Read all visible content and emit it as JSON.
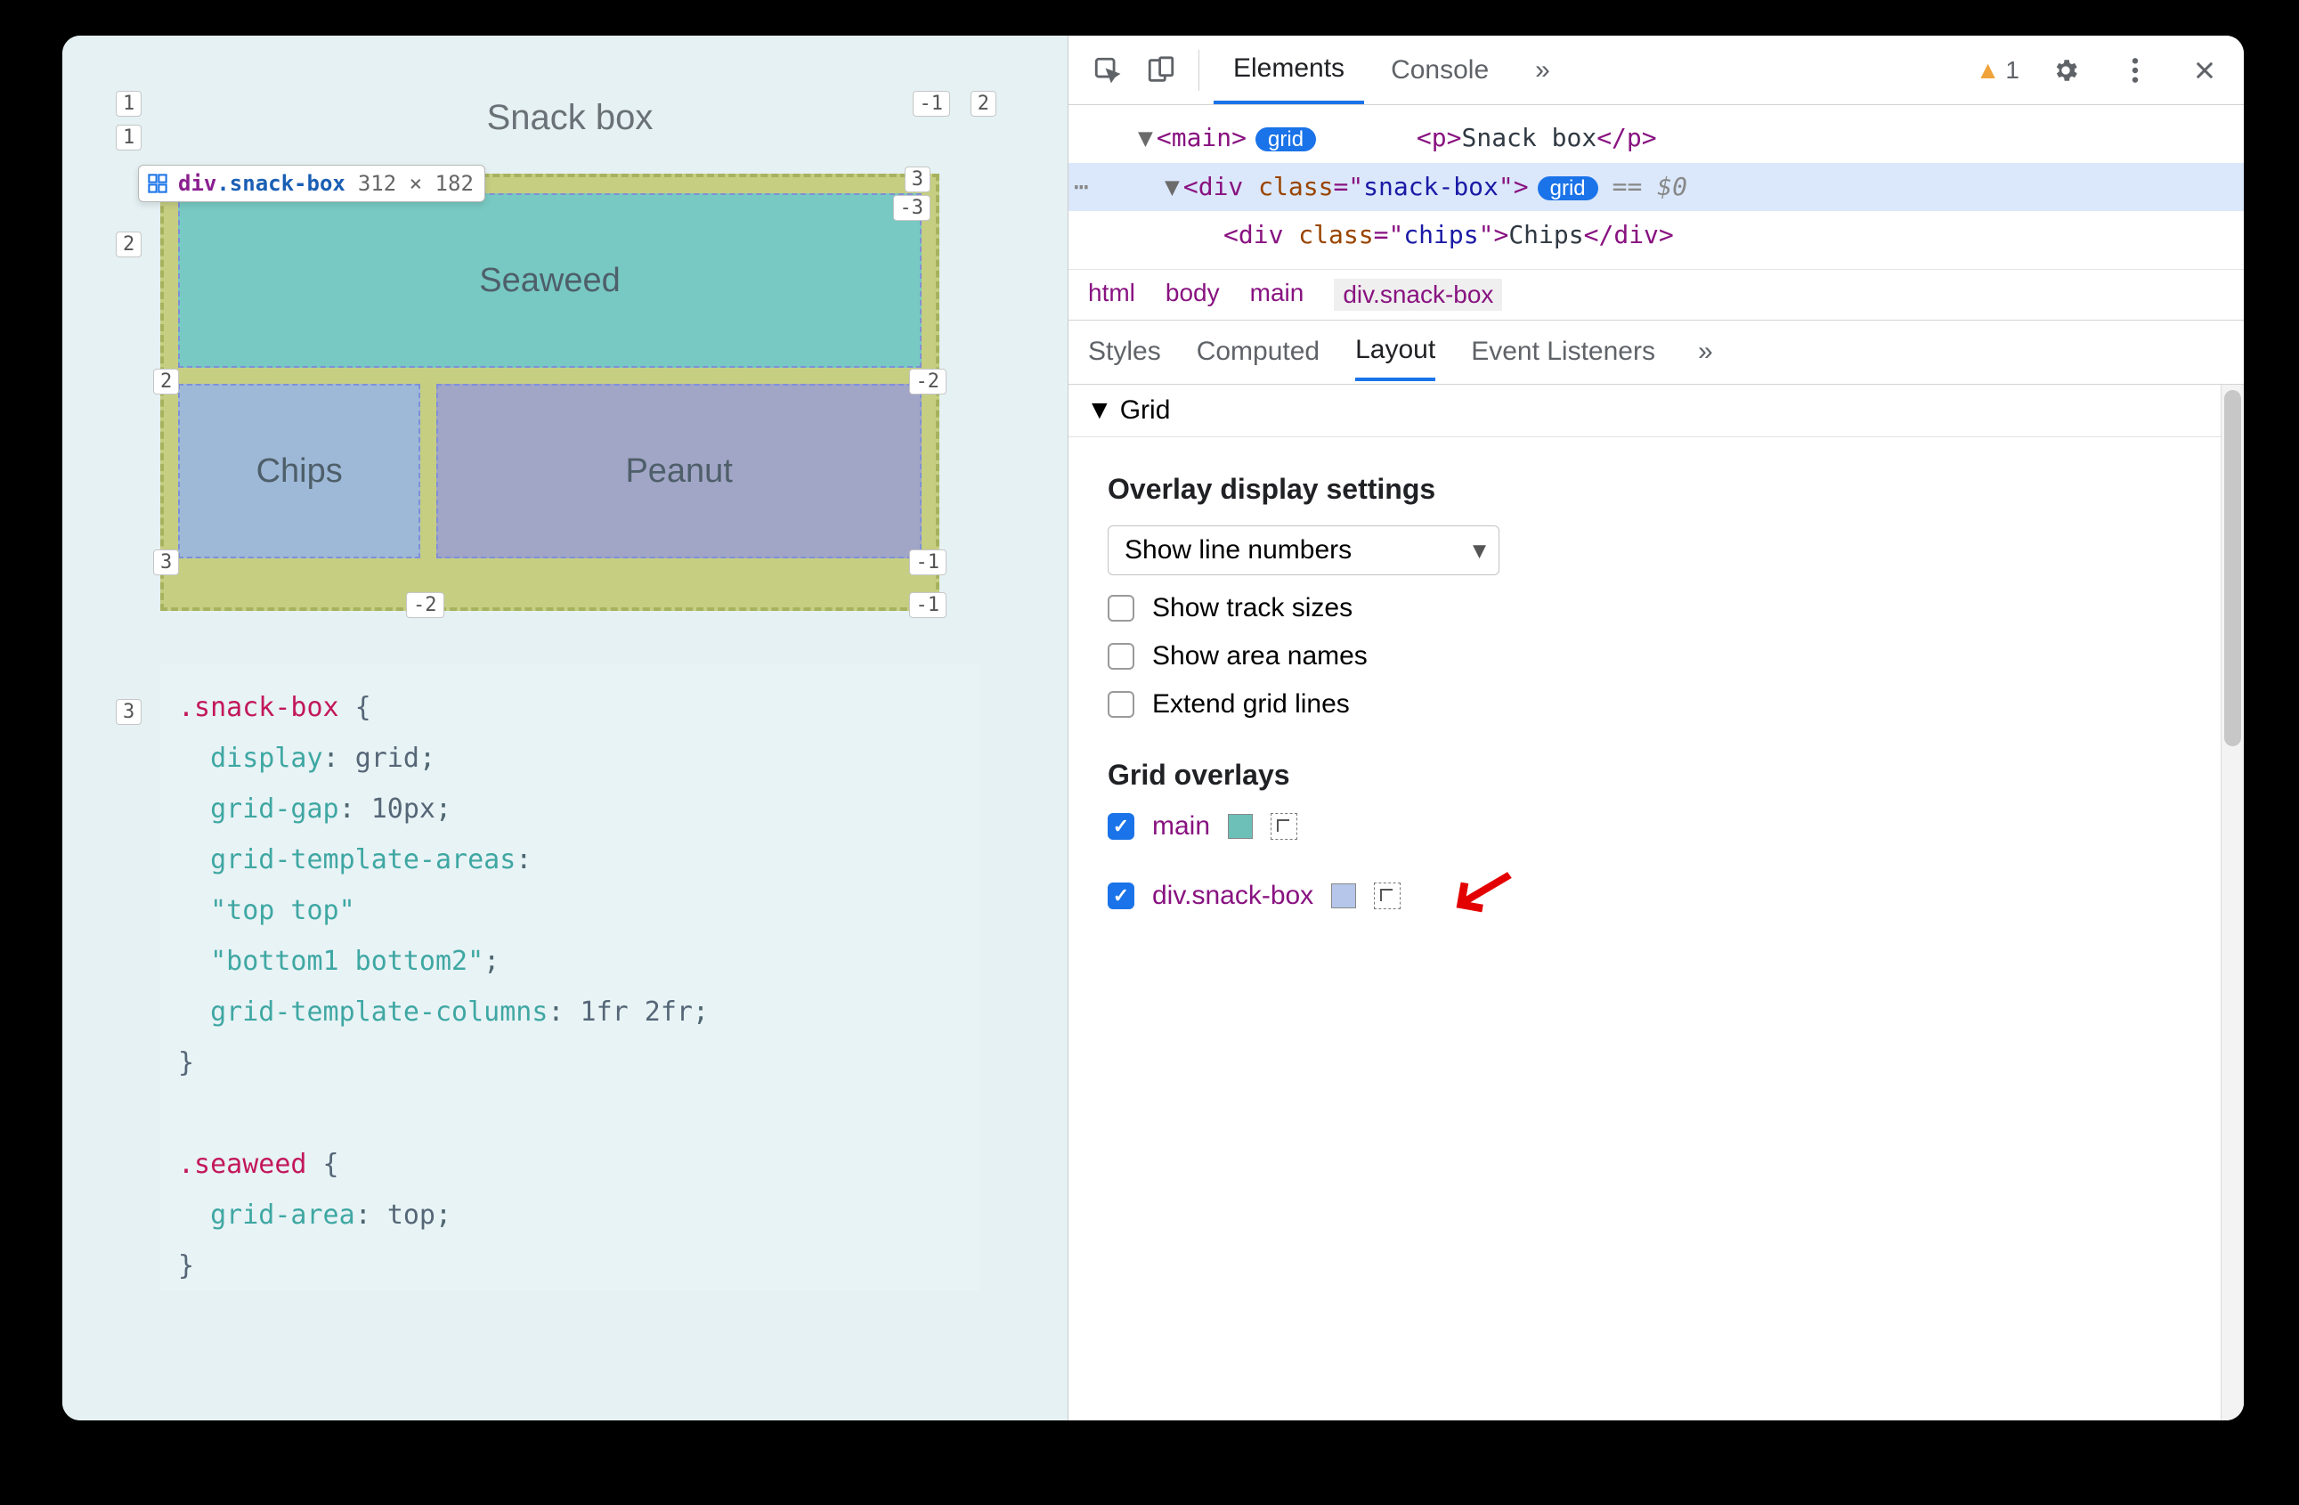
{
  "preview": {
    "title": "Snack box",
    "tooltip_div": "div",
    "tooltip_cls": ".snack-box",
    "tooltip_dims": "312 × 182",
    "cells": {
      "seaweed": "Seaweed",
      "chips": "Chips",
      "peanut": "Peanut"
    },
    "grid_labels": {
      "outer_top_left": "1",
      "outer_top_right_neg": "-1",
      "outer_top_right_pos": "2",
      "outer_row2_left": "2",
      "inner_top_left": "1",
      "inner_top_mid": "2",
      "inner_top_right_neg": "-3",
      "inner_top_right_pos": "3",
      "inner_row2_left": "2",
      "inner_row2_right": "-2",
      "inner_bot_left": "3",
      "inner_bot_mid": "-2",
      "inner_bot_right_neg": "-1",
      "inner_bot_right_pos": "-1",
      "outer_bot_left": "3"
    }
  },
  "code": {
    "l1_sel": ".snack-box",
    "l1_brace": " {",
    "l2_prop": "display",
    "l2_val": "grid",
    "l3_prop": "grid-gap",
    "l3_val": "10px",
    "l4_prop": "grid-template-areas",
    "l5_val": "\"top top\"",
    "l6_val": "\"bottom1 bottom2\"",
    "l7_prop": "grid-template-columns",
    "l7_val": "1fr 2fr",
    "l8_brace": "}",
    "l10_sel": ".seaweed",
    "l10_brace": " {",
    "l11_prop": "grid-area",
    "l11_val": "top",
    "l12_brace": "}"
  },
  "toolbar": {
    "tab_elements": "Elements",
    "tab_console": "Console",
    "more": "»",
    "warn_count": "1"
  },
  "dom": {
    "main_open_tag": "main",
    "grid_badge": "grid",
    "p_tag": "p",
    "p_text": "Snack box",
    "div_tag": "div",
    "attr_class": "class",
    "val_snackbox": "snack-box",
    "dollar": "== $0",
    "chips_tag": "div",
    "chips_cls": "chips",
    "chips_text": "Chips"
  },
  "breadcrumb": {
    "c1": "html",
    "c2": "body",
    "c3": "main",
    "c4": "div.snack-box"
  },
  "subtabs": {
    "styles": "Styles",
    "computed": "Computed",
    "layout": "Layout",
    "listeners": "Event Listeners",
    "more": "»"
  },
  "layout": {
    "section": "Grid",
    "overlay_settings": "Overlay display settings",
    "select_value": "Show line numbers",
    "chk_track": "Show track sizes",
    "chk_area": "Show area names",
    "chk_extend": "Extend grid lines",
    "grid_overlays": "Grid overlays",
    "overlay_main": "main",
    "overlay_snack": "div.snack-box",
    "swatch_main": "#6cc0b7",
    "swatch_snack": "#b6c6ea"
  }
}
